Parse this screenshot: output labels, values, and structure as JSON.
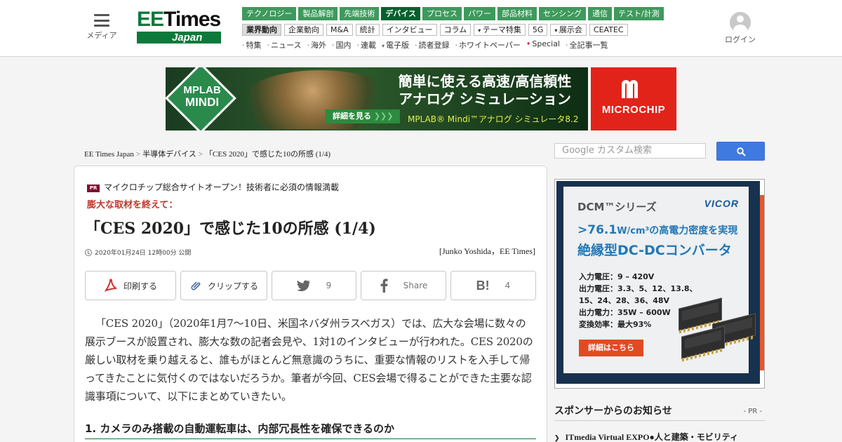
{
  "header": {
    "menu_label": "メディア",
    "logo": {
      "ee": "EE",
      "times": "Times",
      "region": "Japan"
    },
    "nav_primary": [
      {
        "label": "テクノロジー",
        "active": false
      },
      {
        "label": "製品解剖",
        "active": false
      },
      {
        "label": "先端技術",
        "active": false
      },
      {
        "label": "デバイス",
        "active": true
      },
      {
        "label": "プロセス",
        "active": false
      },
      {
        "label": "パワー",
        "active": false
      },
      {
        "label": "部品材料",
        "active": false
      },
      {
        "label": "センシング",
        "active": false
      },
      {
        "label": "通信",
        "active": false
      },
      {
        "label": "テスト/計測",
        "active": false
      }
    ],
    "nav_secondary": [
      {
        "label": "業界動向",
        "active": true,
        "dropdown": false
      },
      {
        "label": "企業動向",
        "active": false,
        "dropdown": false
      },
      {
        "label": "M&A",
        "active": false,
        "dropdown": false
      },
      {
        "label": "統計",
        "active": false,
        "dropdown": false
      },
      {
        "label": "インタビュー",
        "active": false,
        "dropdown": false
      },
      {
        "label": "コラム",
        "active": false,
        "dropdown": false
      },
      {
        "label": "テーマ特集",
        "active": false,
        "dropdown": true
      },
      {
        "label": "5G",
        "active": false,
        "dropdown": false
      },
      {
        "label": "展示会",
        "active": false,
        "dropdown": true
      },
      {
        "label": "CEATEC",
        "active": false,
        "dropdown": false
      }
    ],
    "nav_tertiary": [
      {
        "label": "特集",
        "style": "plain"
      },
      {
        "label": "ニュース",
        "style": "plain"
      },
      {
        "label": "海外",
        "style": "plain"
      },
      {
        "label": "国内",
        "style": "plain"
      },
      {
        "label": "連載",
        "style": "plain"
      },
      {
        "label": "電子版",
        "style": "dropdown"
      },
      {
        "label": "読者登録",
        "style": "plain"
      },
      {
        "label": "ホワイトペーパー",
        "style": "plain"
      },
      {
        "label": "Special",
        "style": "red"
      },
      {
        "label": "全記事一覧",
        "style": "plain"
      }
    ],
    "login_label": "ログイン"
  },
  "banner_ad": {
    "badge_line1": "MPLAB",
    "badge_line2": "MINDI",
    "headline1": "簡単に使える高速/高信頼性",
    "headline2": "アナログ シミュレーション",
    "button": "詳細を見る",
    "product": "MPLAB® Mindi™アナログ シミュレータ8.2",
    "brand": "MICROCHIP"
  },
  "breadcrumb": [
    "EE Times Japan",
    "半導体デバイス",
    "「CES 2020」で感じた10の所感 (1/4)"
  ],
  "search": {
    "placeholder": "Google カスタム検索"
  },
  "article": {
    "pr_badge": "PR",
    "pr_text": "マイクロチップ総合サイトオープン！技術者に必須の情報満載",
    "subtitle": "膨大な取材を終えて：",
    "title": "「CES 2020」で感じた10の所感 (1/4)",
    "date": "2020年01月24日 12時00分 公開",
    "byline": "[Junko Yoshida，EE Times]",
    "tools": {
      "print": "印刷する",
      "clip": "クリップする",
      "twitter_count": "9",
      "facebook": "Share",
      "hatena_count": "4"
    },
    "body": "「CES 2020」（2020年1月7～10日、米国ネバダ州ラスベガス）では、広大な会場に数々の展示ブースが設置され、膨大な数の記者会見や、1対1のインタビューが行われた。CES 2020の厳しい取材を乗り越えると、誰もがほとんど無意識のうちに、重要な情報のリストを入手して帰ってきたことに気付くのではないだろうか。筆者が今回、CES会場で得ることができた主要な認識事項について、以下にまとめていきたい。",
    "heading": "1. カメラのみ搭載の自動運転車は、内部冗長性を確保できるのか"
  },
  "side_ad": {
    "series": "DCM™シリーズ",
    "brand": "VICOR",
    "headline1_value": ">76.1",
    "headline1_unit": "W/cm³",
    "headline1_rest": "の高電力密度を実現",
    "headline2": "絶縁型DC-DCコンバータ",
    "specs": [
      "入力電圧：9 – 420V",
      "出力電圧：3.3、5、12、13.8、",
      "15、24、28、36、48V",
      "出力電力：35W – 600W",
      "変換効率：最大93%"
    ],
    "button": "詳細はこちら"
  },
  "sponsor": {
    "label": "スポンサーからのお知らせ",
    "pr": "- PR -",
    "item": "ITmedia Virtual EXPO●人と建築・モビリティ"
  }
}
